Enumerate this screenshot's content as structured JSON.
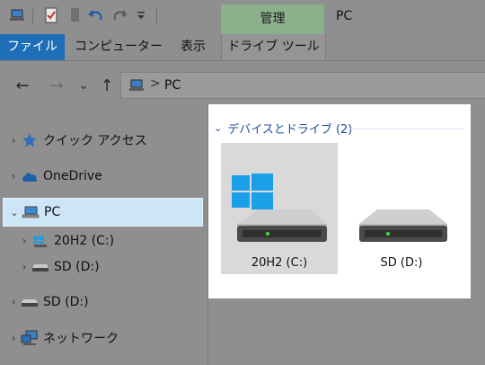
{
  "window": {
    "title": "PC"
  },
  "quick_access_toolbar": {
    "icons": [
      "pc-icon",
      "properties-icon",
      "new-folder-icon",
      "undo-icon",
      "redo-icon",
      "customize-dropdown-icon"
    ]
  },
  "ribbon": {
    "contextual_group": "管理",
    "tabs": [
      {
        "label": "ファイル",
        "active": true
      },
      {
        "label": "コンピューター"
      },
      {
        "label": "表示"
      },
      {
        "label": "ドライブ ツール"
      }
    ]
  },
  "navigation": {
    "back": "←",
    "forward": "→",
    "recent": "⌄",
    "up": "↑",
    "address_path": [
      "PC"
    ],
    "separator": ">"
  },
  "nav_pane": {
    "items": [
      {
        "label": "クイック アクセス",
        "icon": "star-icon",
        "level": 0,
        "expanded": false
      },
      {
        "label": "OneDrive",
        "icon": "cloud-icon",
        "level": 0,
        "expanded": false
      },
      {
        "label": "PC",
        "icon": "pc-icon",
        "level": 0,
        "expanded": true,
        "selected": true
      },
      {
        "label": "20H2 (C:)",
        "icon": "windows-drive-icon",
        "level": 1,
        "expanded": false
      },
      {
        "label": "SD (D:)",
        "icon": "drive-icon",
        "level": 1,
        "expanded": false
      },
      {
        "label": "SD (D:)",
        "icon": "drive-icon",
        "level": 0,
        "expanded": false
      },
      {
        "label": "ネットワーク",
        "icon": "network-icon",
        "level": 0,
        "expanded": false
      }
    ]
  },
  "content": {
    "group_title": "デバイスとドライブ (2)",
    "drives": [
      {
        "label": "20H2 (C:)",
        "icon": "windows-drive-icon",
        "selected": true
      },
      {
        "label": "SD (D:)",
        "icon": "drive-icon",
        "selected": false
      }
    ]
  },
  "colors": {
    "file_tab": "#1e6fb8",
    "manage_tab": "#8cb08c",
    "selection": "#cde6f7",
    "group_title": "#1e4f9a",
    "windows_blue": "#1aa0e8",
    "drive_led": "#3fd13f"
  }
}
